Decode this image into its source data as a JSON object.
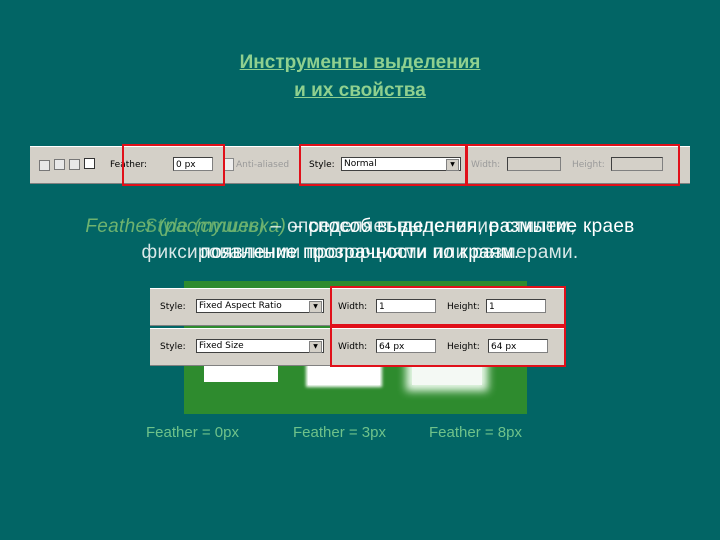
{
  "slide": {
    "title_line1": "Инструменты выделения",
    "title_line2": "и их свойства"
  },
  "toolbar1": {
    "feather_label": "Feather:",
    "feather_value": "0 px",
    "anti_aliased_label": "Anti-aliased",
    "style_label": "Style:",
    "style_value": "Normal",
    "width_label": "Width:",
    "width_value": "",
    "height_label": "Height:",
    "height_value": ""
  },
  "overlay_text": [
    {
      "term": "Feather (растушевка)",
      "line1": " – способ выделения, размытие краев",
      "line2": "появление прозрачности по краям."
    },
    {
      "term": "Style (стиль)",
      "line1": " – определяет выделение стилем,",
      "line2": "фиксированными пропорциями или размерами."
    }
  ],
  "toolbar2": {
    "style_label": "Style:",
    "style_value": "Fixed Aspect Ratio",
    "width_label": "Width:",
    "width_value": "1",
    "height_label": "Height:",
    "height_value": "1"
  },
  "toolbar3": {
    "style_label": "Style:",
    "style_value": "Fixed Size",
    "width_label": "Width:",
    "width_value": "64 px",
    "height_label": "Height:",
    "height_value": "64 px"
  },
  "feather_examples": [
    "Feather = 0px",
    "Feather = 3px",
    "Feather = 8px"
  ],
  "colors": {
    "background": "#026565",
    "accent": "#8fd08f",
    "highlight": "#e0101a",
    "canvas": "#2e8b2e"
  }
}
